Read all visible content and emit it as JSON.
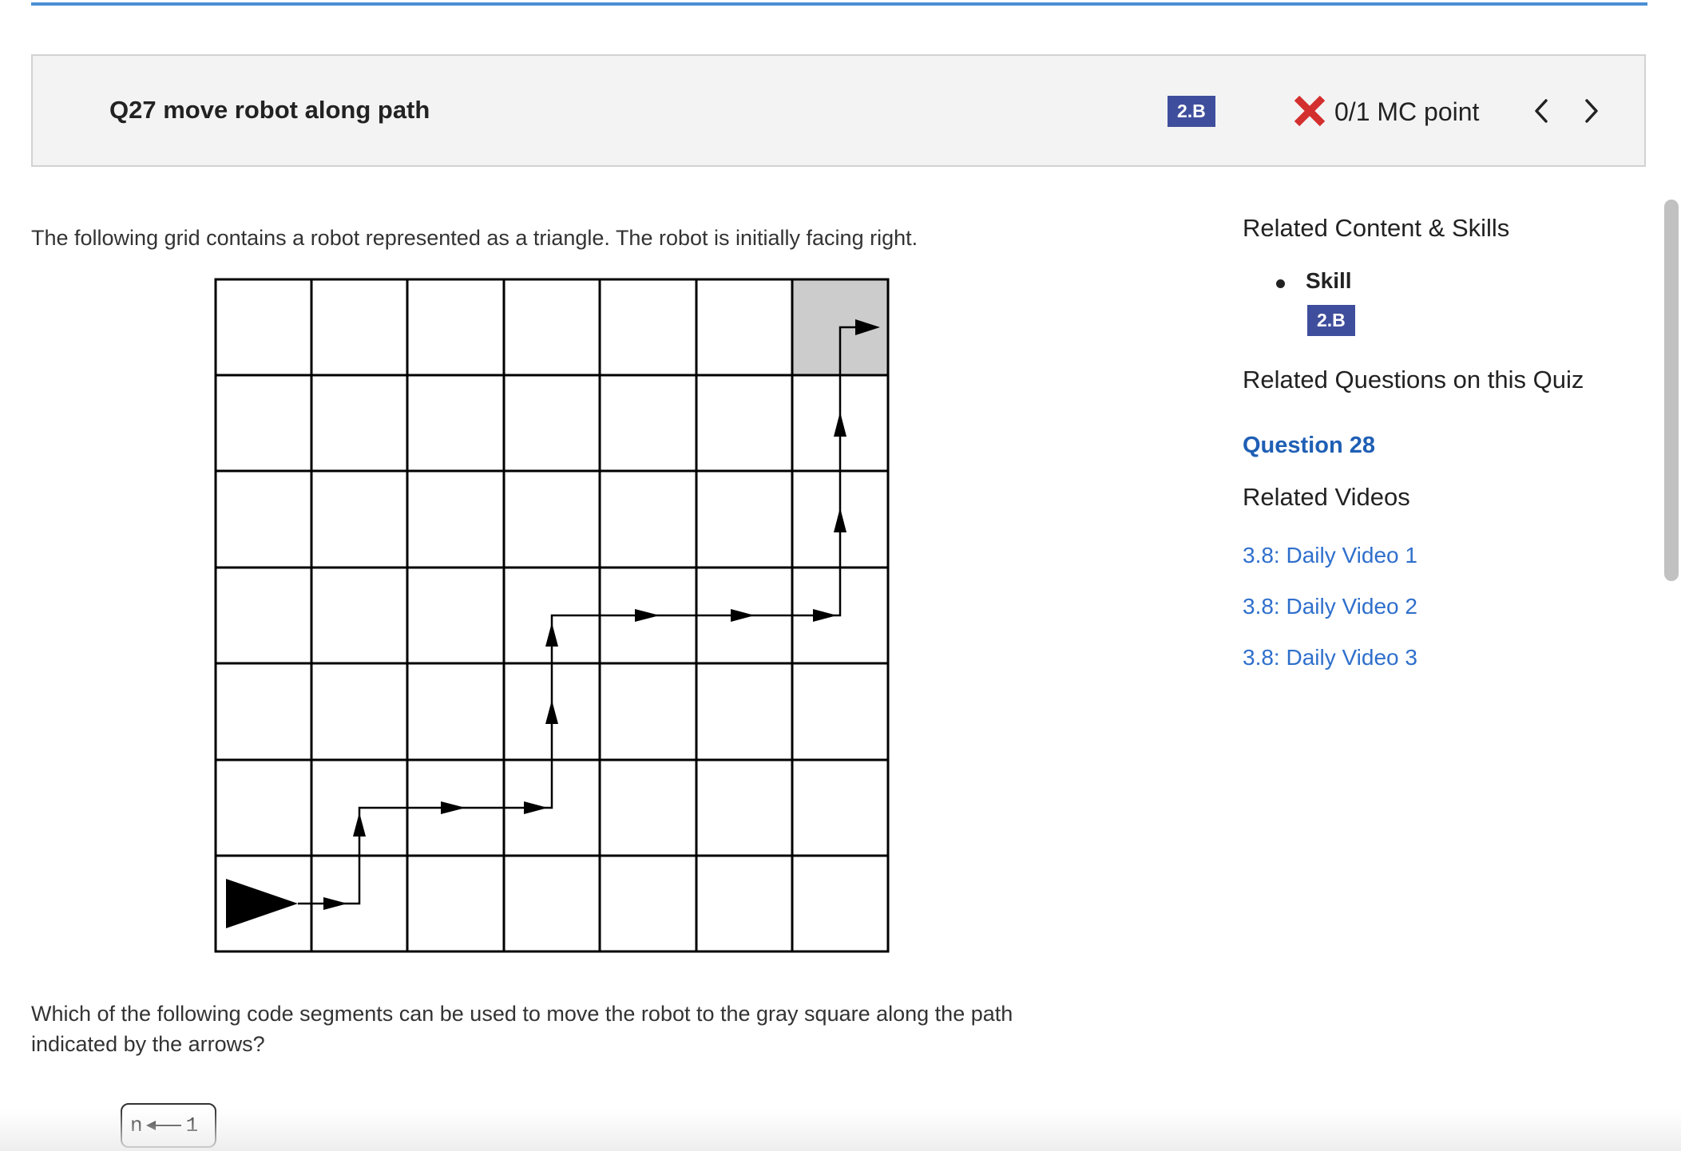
{
  "header": {
    "title": "Q27 move robot along path",
    "skill_badge": "2.B",
    "score": "0/1 MC point"
  },
  "question": {
    "prompt": "The following grid contains a robot represented as a triangle. The robot is initially facing right.",
    "question_text": "Which of the following code segments can be used to move the robot to the gray square along the path indicated by the arrows?",
    "code_preview": {
      "variable": "n",
      "value": "1"
    }
  },
  "sidebar": {
    "related_content_heading": "Related Content & Skills",
    "skill_label": "Skill",
    "skill_badge": "2.B",
    "related_questions_heading": "Related Questions on this Quiz",
    "related_question_link": "Question 28",
    "related_videos_heading": "Related Videos",
    "videos": [
      "3.8: Daily Video 1",
      "3.8: Daily Video 2",
      "3.8: Daily Video 3"
    ]
  },
  "colors": {
    "badge": "#3f4e9c",
    "link": "#2f6fcc",
    "incorrect": "#d32f2f",
    "top_rule": "#4a8fd4",
    "goal_cell": "#cccccc"
  }
}
